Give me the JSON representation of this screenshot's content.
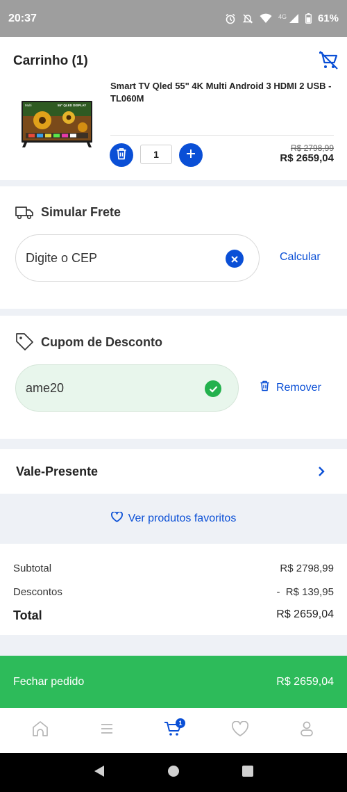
{
  "status_bar": {
    "time": "20:37",
    "network": "4G",
    "battery": "61%"
  },
  "cart": {
    "title": "Carrinho (1)",
    "product": {
      "name": "Smart TV Qled 55\" 4K Multi Android 3 HDMI 2 USB - TL060M",
      "image_brand": "Multi",
      "image_label": "55\" QLED DISPLAY",
      "quantity": "1",
      "price_old": "R$ 2798,99",
      "price_new": "R$ 2659,04"
    }
  },
  "frete": {
    "title": "Simular Frete",
    "placeholder": "Digite o CEP",
    "action": "Calcular"
  },
  "cupom": {
    "title": "Cupom de Desconto",
    "code": "ame20",
    "remove_label": "Remover"
  },
  "vale_presente": {
    "title": "Vale-Presente"
  },
  "favorites": {
    "label": "Ver produtos favoritos"
  },
  "totals": {
    "subtotal_label": "Subtotal",
    "subtotal_value": "R$ 2798,99",
    "discount_label": "Descontos",
    "discount_value": "-  R$ 139,95",
    "total_label": "Total",
    "total_value": "R$ 2659,04"
  },
  "checkout": {
    "label": "Fechar pedido",
    "amount": "R$ 2659,04"
  },
  "bottom_nav": {
    "items": [
      "home-icon",
      "menu-icon",
      "cart-icon",
      "heart-icon",
      "profile-icon"
    ],
    "cart_count": "1",
    "active": "cart-icon"
  },
  "colors": {
    "primary": "#0a4fd6",
    "success": "#2dbb5a",
    "check": "#23b14d"
  }
}
